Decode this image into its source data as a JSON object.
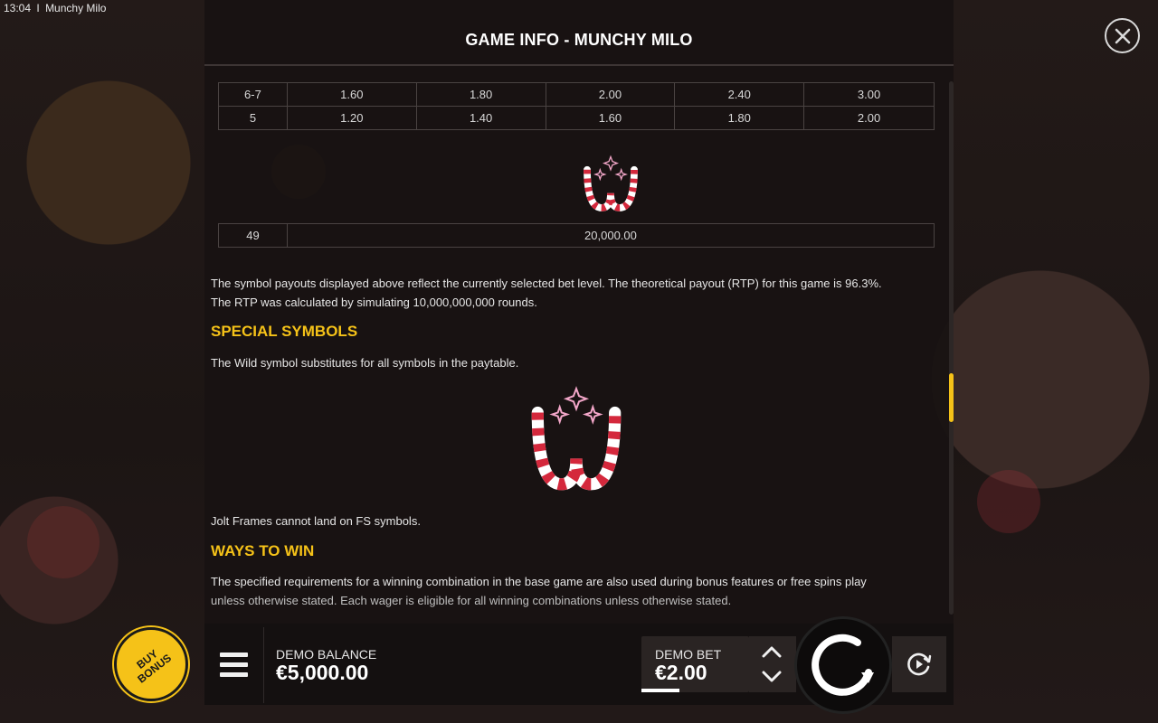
{
  "statusbar": {
    "time": "13:04",
    "separator": "I",
    "app_name": "Munchy Milo"
  },
  "panel": {
    "title": "GAME INFO - MUNCHY MILO"
  },
  "paytable_top": {
    "rows": [
      {
        "count": "6-7",
        "values": [
          "1.60",
          "1.80",
          "2.00",
          "2.40",
          "3.00"
        ]
      },
      {
        "count": "5",
        "values": [
          "1.20",
          "1.40",
          "1.60",
          "1.80",
          "2.00"
        ]
      }
    ]
  },
  "paytable_wild": {
    "count": "49",
    "value": "20,000.00"
  },
  "content": {
    "rtp_line1": "The symbol payouts displayed above reflect the currently selected bet level. The theoretical payout (RTP) for this game is 96.3%.",
    "rtp_line2": "The RTP was calculated by simulating 10,000,000,000 rounds.",
    "special_heading": "SPECIAL SYMBOLS",
    "wild_text": "The Wild symbol substitutes for all symbols in the paytable.",
    "jolt_text": "Jolt Frames cannot land on FS symbols.",
    "ways_heading": "WAYS TO WIN",
    "ways_line1": "The specified requirements for a winning combination in the base game are also used during bonus features or free spins play",
    "ways_line2": "unless otherwise stated. Each wager is eligible for all winning combinations unless otherwise stated."
  },
  "bottom": {
    "buy_bonus_line1": "BUY",
    "buy_bonus_line2": "BONUS",
    "balance_label": "DEMO BALANCE",
    "balance_value": "€5,000.00",
    "bet_label": "DEMO BET",
    "bet_value": "€2.00"
  },
  "icons": {
    "close": "close-icon",
    "menu": "hamburger-icon",
    "bet_up": "chevron-up-icon",
    "bet_down": "chevron-down-icon",
    "spin": "spin-arrow-icon",
    "autoplay": "autoplay-icon",
    "wild": "candy-cane-wild-icon"
  },
  "colors": {
    "accent": "#f5c218",
    "panel": "#181212",
    "wild_red": "#d4283c"
  }
}
